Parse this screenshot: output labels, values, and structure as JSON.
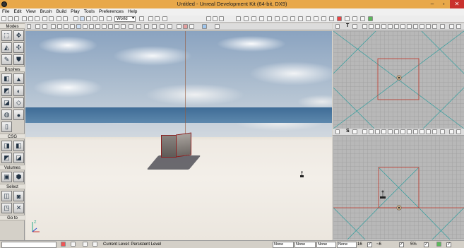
{
  "window": {
    "title": "Untitled - Unreal Development Kit (64-bit, DX9)",
    "minimize_glyph": "–",
    "maximize_glyph": "▫",
    "close_glyph": "✕"
  },
  "menu": [
    "File",
    "Edit",
    "View",
    "Brush",
    "Build",
    "Play",
    "Tools",
    "Preferences",
    "Help"
  ],
  "toolbar": {
    "coordinate_system": "World"
  },
  "left_panel": {
    "modes_label": "Modes",
    "sections": {
      "brushes": "Brushes",
      "csg": "CSG",
      "volumes": "Volumes",
      "select": "Select",
      "goto": "Go to"
    }
  },
  "viewports": {
    "top_label": "T",
    "side_label": "S",
    "colors": {
      "ortho_lines": "#2f9e9e",
      "builder_brush": "#c0392b",
      "ortho_bg": "#b8b8b8"
    }
  },
  "status": {
    "current_level": "Current Level:  Persistent Level",
    "fields": [
      "None",
      "None",
      "None",
      "None"
    ],
    "grid_size": "16",
    "rotation_snap": "5%",
    "scale_snap": "~6"
  }
}
